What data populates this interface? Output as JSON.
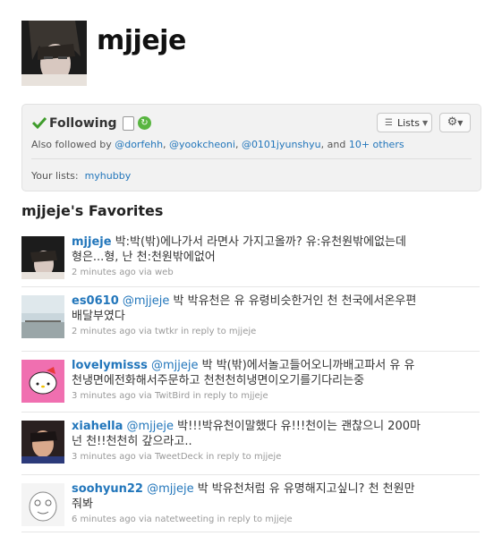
{
  "profile": {
    "screen_name": "mjjeje"
  },
  "follow_box": {
    "following_label": "Following",
    "also_prefix": "Also followed by",
    "also_users": [
      "@dorfehh",
      "@yookcheoni",
      "@0101jyunshyu"
    ],
    "also_and": ", and",
    "also_more": "10+ others",
    "lists_button": "Lists",
    "your_lists_label": "Your lists:",
    "your_lists_item": "myhubby"
  },
  "favorites": {
    "heading": "mjjeje's Favorites",
    "tweets": [
      {
        "author": "mjjeje",
        "mention": "",
        "text_line1": "박:박(밖)에나가서 라면사 가지고올까? 유:유천원밖에없는데",
        "text_line2": "형은...형, 난 천:천원밖에없어",
        "time": "2 minutes ago",
        "via": "via",
        "source": "web",
        "reply": ""
      },
      {
        "author": "es0610",
        "mention": "@mjjeje",
        "text_line1": "박 박유천은 유 유령비슷한거인 천 천국에서온우편",
        "text_line2": "배달부였다",
        "time": "2 minutes ago",
        "via": "via",
        "source": "twtkr",
        "reply": "in reply to mjjeje"
      },
      {
        "author": "lovelymisss",
        "mention": "@mjjeje",
        "text_line1": "박 박(밖)에서놀고들어오니까배고파서 유 유",
        "text_line2": "천냉면에전화해서주문하고 천천천히냉면이오기를기다리는중",
        "time": "3 minutes ago",
        "via": "via",
        "source": "TwitBird",
        "reply": "in reply to mjjeje"
      },
      {
        "author": "xiahella",
        "mention": "@mjjeje",
        "text_line1": "박!!!박유천이말했다 유!!!천이는 괜찮으니 200마",
        "text_line2": "넌 천!!천천히 갚으라고..",
        "time": "3 minutes ago",
        "via": "via",
        "source": "TweetDeck",
        "reply": "in reply to mjjeje"
      },
      {
        "author": "soohyun22",
        "mention": "@mjjeje",
        "text_line1": "박 박유천처럼 유 유명해지고싶니? 천 천원만",
        "text_line2": "줘봐",
        "time": "6 minutes ago",
        "via": "via",
        "source": "natetweeting",
        "reply": "in reply to mjjeje"
      }
    ]
  }
}
